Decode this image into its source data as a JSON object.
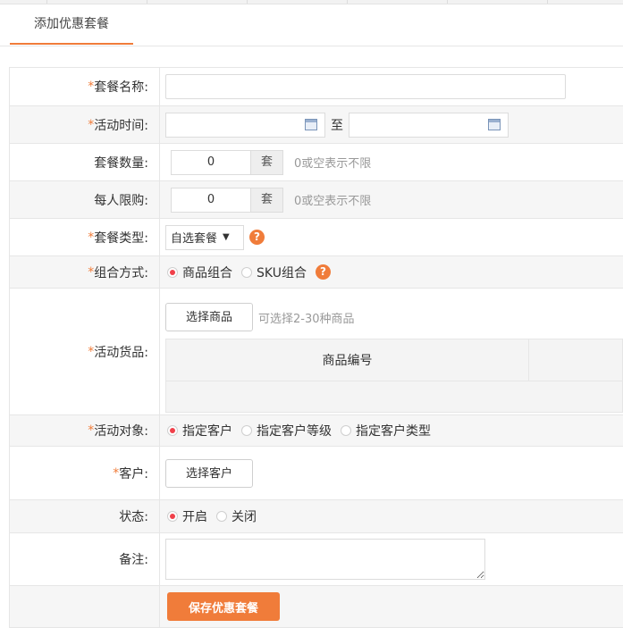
{
  "tab": {
    "label": "添加优惠套餐"
  },
  "fields": {
    "package_name": {
      "label": "套餐名称:",
      "value": ""
    },
    "activity_time": {
      "label": "活动时间:",
      "separator": "至",
      "start": "",
      "end": ""
    },
    "package_quantity": {
      "label": "套餐数量:",
      "value": "0",
      "unit": "套",
      "hint": "0或空表示不限"
    },
    "per_person_limit": {
      "label": "每人限购:",
      "value": "0",
      "unit": "套",
      "hint": "0或空表示不限"
    },
    "package_type": {
      "label": "套餐类型:",
      "selected": "自选套餐"
    },
    "combine_mode": {
      "label": "组合方式:",
      "options": [
        "商品组合",
        "SKU组合"
      ],
      "selected_index": 0
    },
    "activity_goods": {
      "label": "活动货品:",
      "select_button": "选择商品",
      "hint": "可选择2-30种商品",
      "column_header": "商品编号"
    },
    "activity_target": {
      "label": "活动对象:",
      "options": [
        "指定客户",
        "指定客户等级",
        "指定客户类型"
      ],
      "selected_index": 0
    },
    "customer": {
      "label": "客户:",
      "select_button": "选择客户"
    },
    "status": {
      "label": "状态:",
      "options": [
        "开启",
        "关闭"
      ],
      "selected_index": 0
    },
    "remark": {
      "label": "备注:",
      "value": ""
    }
  },
  "save_button": "保存优惠套餐",
  "required_mark": "*",
  "help_glyph": "?",
  "colors": {
    "accent": "#f07c3a",
    "radio_on": "#f0404a",
    "hint": "#999999",
    "border": "#e6e6e6"
  },
  "icons": {
    "calendar": "calendar-icon",
    "help": "help-icon",
    "dropdown": "chevron-down-icon"
  }
}
